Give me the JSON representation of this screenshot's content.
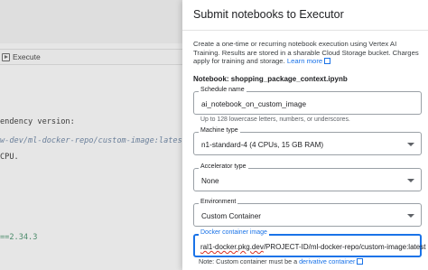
{
  "notebook_bg": {
    "toolbar": {
      "execute_label": "Execute"
    },
    "lines": [
      "endency version:",
      "w-dev/ml-docker-repo/custom-image:latest`",
      "CPU.",
      "==2.34.3"
    ]
  },
  "panel": {
    "title": "Submit notebooks to Executor",
    "description": "Create a one-time or recurring notebook execution using Vertex AI Training. Results are stored in a sharable Cloud Storage bucket. Charges apply for training and storage.",
    "learn_more": "Learn more",
    "notebook_label": "Notebook:",
    "notebook_name": "shopping_package_context.ipynb",
    "schedule_name": {
      "label": "Schedule name",
      "value": "ai_notebook_on_custom_image",
      "hint": "Up to 128 lowercase letters, numbers, or underscores."
    },
    "machine_type": {
      "label": "Machine type",
      "value": "n1-standard-4 (4 CPUs, 15 GB RAM)"
    },
    "accelerator_type": {
      "label": "Accelerator type",
      "value": "None"
    },
    "environment": {
      "label": "Environment",
      "value": "Custom Container"
    },
    "docker_image": {
      "label": "Docker container image",
      "value_prefix": "ral1-docker.pkg.dev",
      "value_rest": "/PROJECT-ID/ml-docker-repo/custom-image:latest"
    },
    "note_prefix": "Note: Custom container must be a",
    "note_link": "derivative container"
  },
  "colors": {
    "accent": "#1a73e8",
    "error_underline": "#d93025"
  }
}
